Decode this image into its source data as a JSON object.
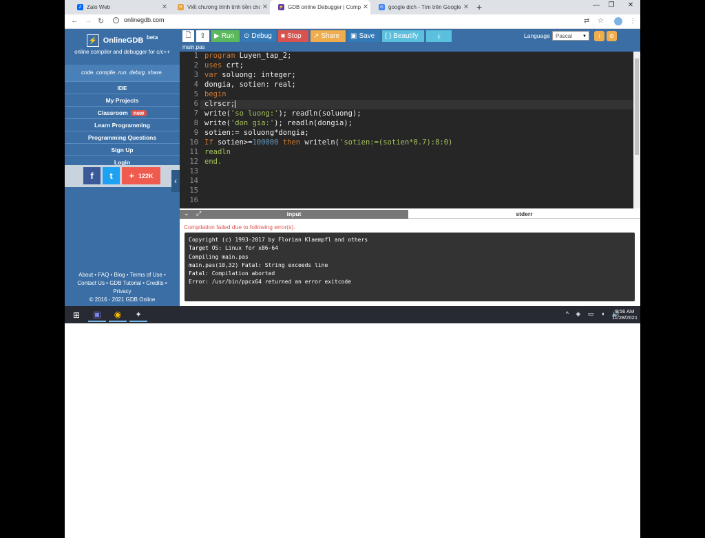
{
  "browser": {
    "tabs": [
      {
        "title": "Zalo Web",
        "fav_color": "#0068ff",
        "fav_glyph": "Z"
      },
      {
        "title": "Viết chương trình tính tiền cho l...",
        "fav_color": "#e8a23c",
        "fav_glyph": "H"
      },
      {
        "title": "GDB online Debugger | Compiler...",
        "fav_color": "#5b3fa6",
        "fav_glyph": "⚡",
        "active": true
      },
      {
        "title": "google dịch - Tìm trên Google",
        "fav_color": "#4285f4",
        "fav_glyph": "G"
      }
    ],
    "new_tab": "+",
    "url": "onlinegdb.com",
    "window_controls": {
      "minimize": "—",
      "restore": "❐",
      "close": "✕"
    }
  },
  "sidebar": {
    "brand": "OnlineGDB",
    "beta": "beta",
    "subtitle": "online compiler and debugger for c/c++",
    "slogan": "code. compile. run. debug. share.",
    "nav": [
      {
        "label": "IDE"
      },
      {
        "label": "My Projects"
      },
      {
        "label": "Classroom",
        "badge": "new"
      },
      {
        "label": "Learn Programming"
      },
      {
        "label": "Programming Questions"
      },
      {
        "label": "Sign Up"
      },
      {
        "label": "Login"
      }
    ],
    "social": {
      "facebook": "f",
      "twitter": "t",
      "share_count": "122K"
    },
    "footer": {
      "line1": "About • FAQ • Blog • Terms of Use •",
      "line2": "Contact Us • GDB Tutorial • Credits •",
      "line3": "Privacy",
      "line4": "© 2016 - 2021 GDB Online"
    }
  },
  "toolbar": {
    "run": "Run",
    "debug": "Debug",
    "stop": "Stop",
    "share": "Share",
    "save": "Save",
    "beautify": "{ } Beautify",
    "language_label": "Language",
    "language_value": "Pascal",
    "colors": {
      "run": "#5cb85c",
      "debug": "#337ab7",
      "stop": "#d9534f",
      "share": "#f0ad4e",
      "save": "#337ab7",
      "beautify": "#5bc0de",
      "download": "#5bc0de"
    }
  },
  "editor": {
    "file_name": "main.pas",
    "line_numbers": [
      "1",
      "2",
      "3",
      "4",
      "5",
      "6",
      "7",
      "8",
      "9",
      "10",
      "11",
      "12",
      "13",
      "14",
      "15",
      "16"
    ]
  },
  "code": {
    "l1a": "program",
    "l1b": " Luyen_tap_2;",
    "l2a": "uses",
    "l2b": " crt;",
    "l3a": "var",
    "l3b": " soluong: integer;",
    "l4": "dongia, sotien: real;",
    "l5": "begin",
    "l6": "clrscr;",
    "l7a": "write(",
    "l7b": "'so luong:'",
    "l7c": "); readln(soluong);",
    "l8a": "write(",
    "l8b": "'don gia:'",
    "l8c": "); readln(dongia);",
    "l9": "sotien:= soluong*dongia;",
    "l10a": "If",
    "l10b": " sotien>=",
    "l10c": "100000",
    "l10d": " then",
    "l10e": " writeln(",
    "l10f": "'sotien:=(sotien*0.7):8:0)",
    "l11": "readln",
    "l12": "end."
  },
  "output": {
    "tab_input": "input",
    "tab_stderr": "stderr",
    "error_message": "Compilation failed due to following error(s).",
    "console": [
      "Copyright (c) 1993-2017 by Florian Klaempfl and others",
      "Target OS: Linux for x86-64",
      "Compiling main.pas",
      "main.pas(10,32) Fatal: String exceeds line",
      "Fatal: Compilation aborted",
      "Error: /usr/bin/ppcx64 returned an error exitcode"
    ]
  },
  "taskbar": {
    "time": "9:56 AM",
    "date": "11/28/2021"
  }
}
